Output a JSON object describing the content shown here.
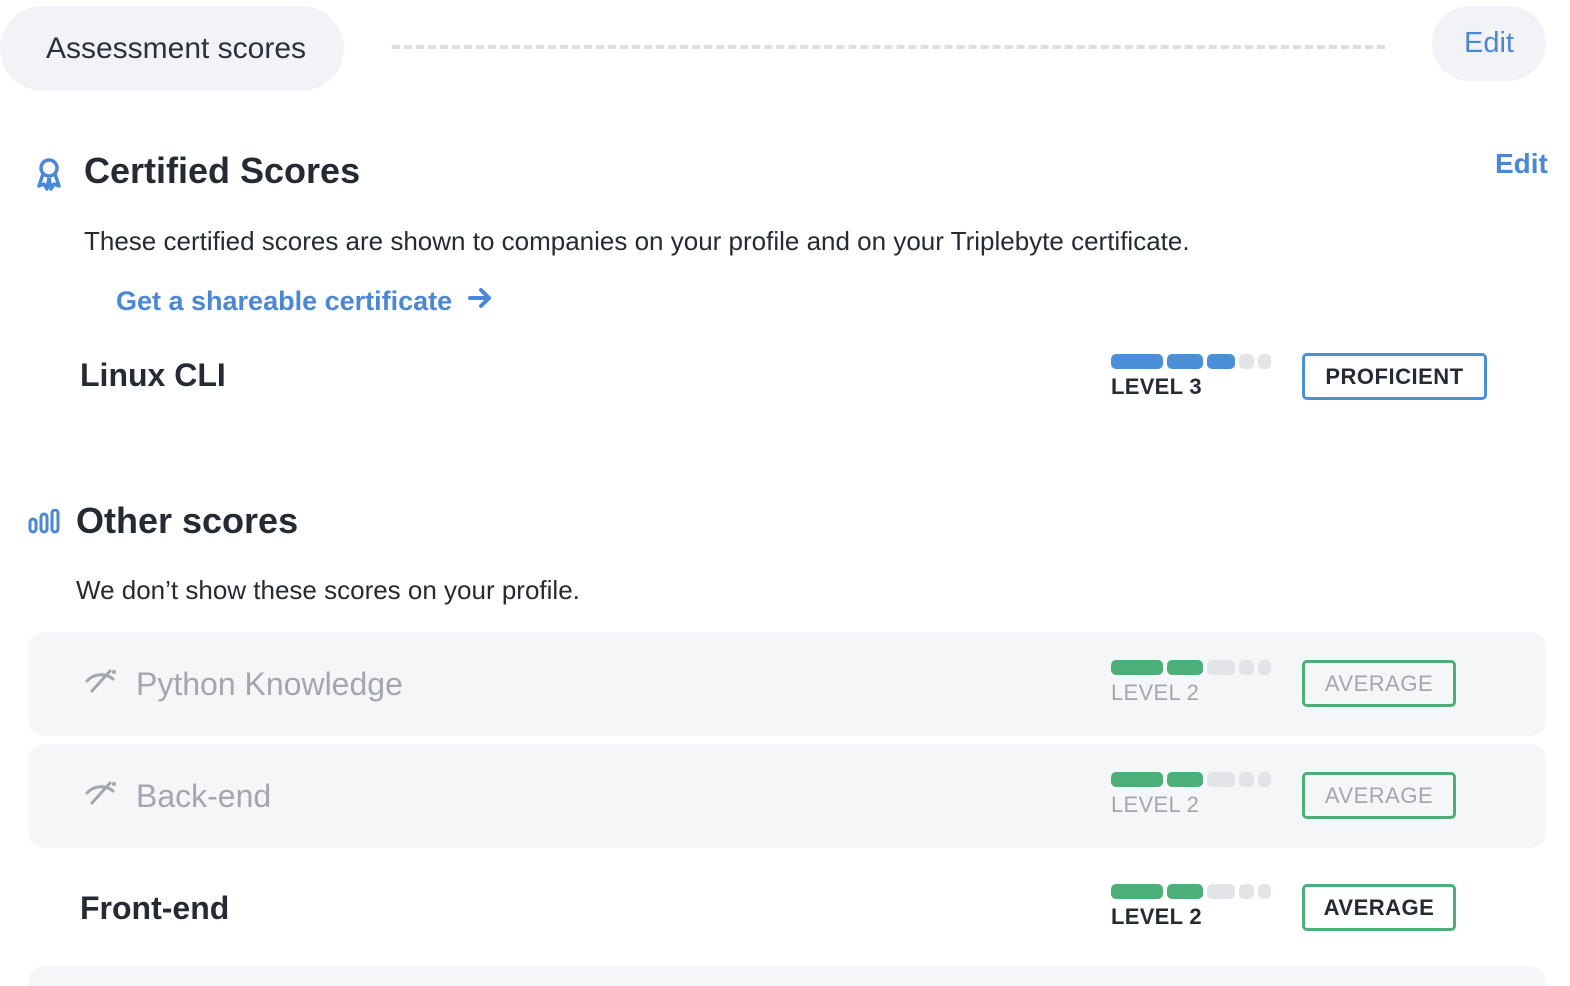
{
  "header": {
    "title": "Assessment scores",
    "edit_label": "Edit"
  },
  "certified": {
    "title": "Certified Scores",
    "edit_label": "Edit",
    "description": "These certified scores are shown to companies on your profile and on your Triplebyte certificate.",
    "cta_label": "Get a shareable certificate",
    "icon": "award-icon",
    "scores": [
      {
        "name": "Linux CLI",
        "level_label": "LEVEL 3",
        "level": 3,
        "max_level": 5,
        "rating": "PROFICIENT",
        "color": "#4a90d9"
      }
    ]
  },
  "other": {
    "title": "Other scores",
    "description": "We don’t show these scores on your profile.",
    "icon": "bar-chart-icon",
    "scores": [
      {
        "name": "Python Knowledge",
        "level_label": "LEVEL 2",
        "level": 2,
        "max_level": 5,
        "rating": "AVERAGE",
        "hidden": true,
        "icon": "eye-off-icon",
        "color": "#4caf7a"
      },
      {
        "name": "Back-end",
        "level_label": "LEVEL 2",
        "level": 2,
        "max_level": 5,
        "rating": "AVERAGE",
        "hidden": true,
        "icon": "eye-off-icon",
        "color": "#4caf7a"
      },
      {
        "name": "Front-end",
        "level_label": "LEVEL 2",
        "level": 2,
        "max_level": 5,
        "rating": "AVERAGE",
        "hidden": false,
        "color": "#4caf7a"
      }
    ]
  },
  "colors": {
    "accent": "#4a87d4",
    "proficient": "#4a90d9",
    "average": "#4caf7a",
    "empty_bar": "#e3e4e7"
  }
}
